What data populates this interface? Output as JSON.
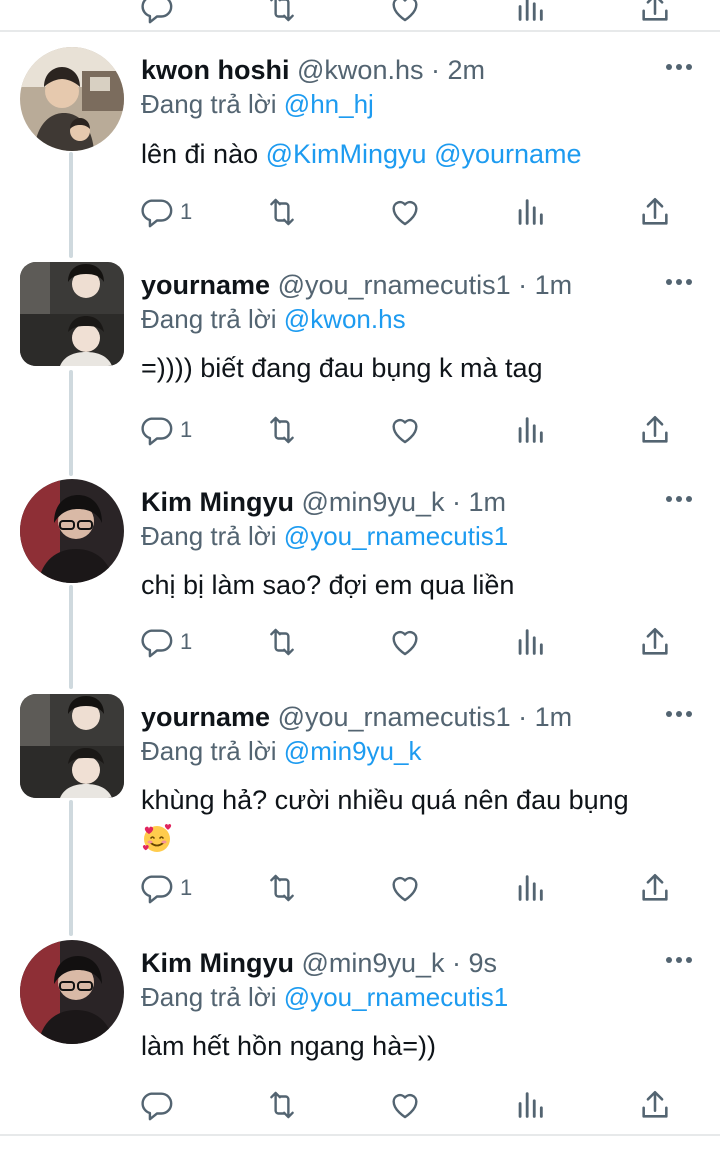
{
  "tweets": [
    {
      "name": "kwon hoshi",
      "handle": "@kwon.hs",
      "time": "· 2m",
      "reply_label": "Đang trả lời",
      "reply_to": "@hn_hj",
      "text": "lên đi nào",
      "mentions": [
        "@KimMingyu",
        "@yourname"
      ],
      "reply_count": "1"
    },
    {
      "name": "yourname",
      "handle": "@you_rnamecutis1",
      "time": "· 1m",
      "reply_label": "Đang trả lời",
      "reply_to": "@kwon.hs",
      "text": "=)))) biết đang đau bụng k mà tag",
      "reply_count": "1"
    },
    {
      "name": "Kim Mingyu",
      "handle": "@min9yu_k",
      "time": "· 1m",
      "reply_label": "Đang trả lời",
      "reply_to": "@you_rnamecutis1",
      "text": "chị bị làm sao? đợi em qua liền",
      "reply_count": "1"
    },
    {
      "name": "yourname",
      "handle": "@you_rnamecutis1",
      "time": "· 1m",
      "reply_label": "Đang trả lời",
      "reply_to": "@min9yu_k",
      "text": "khùng hả? cười nhiều quá nên đau bụng",
      "emoji": "smiling-face-with-hearts",
      "reply_count": "1"
    },
    {
      "name": "Kim Mingyu",
      "handle": "@min9yu_k",
      "time": "· 9s",
      "reply_label": "Đang trả lời",
      "reply_to": "@you_rnamecutis1",
      "text": "làm hết hồn ngang hà=))",
      "reply_count": ""
    }
  ],
  "colors": {
    "link": "#1d9bf0",
    "secondary_text": "#536471",
    "primary_text": "#0f1419",
    "divider": "#e7e9ea",
    "thread_line": "#cfd9de"
  },
  "icons": [
    "reply-icon",
    "retweet-icon",
    "like-icon",
    "views-icon",
    "share-icon",
    "more-icon"
  ]
}
